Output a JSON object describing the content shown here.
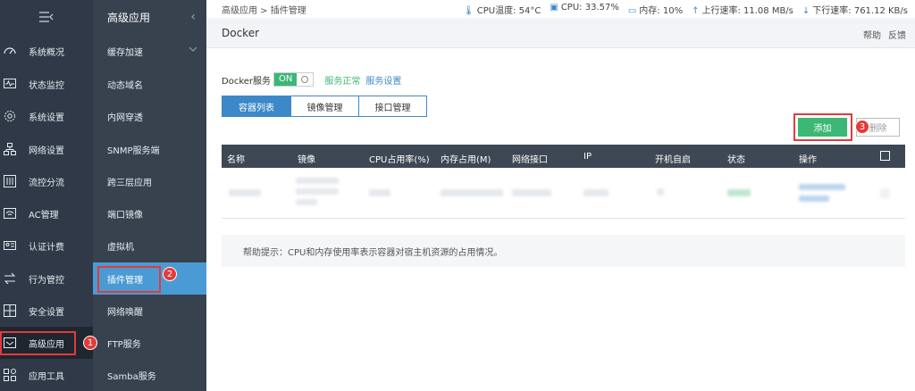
{
  "sidebar": {
    "header_icon": "menu-collapse-icon",
    "items": [
      {
        "label": "系统概况",
        "icon": "dashboard-icon"
      },
      {
        "label": "状态监控",
        "icon": "monitor-icon"
      },
      {
        "label": "系统设置",
        "icon": "gear-icon"
      },
      {
        "label": "网络设置",
        "icon": "network-icon"
      },
      {
        "label": "流控分流",
        "icon": "sliders-icon"
      },
      {
        "label": "AC管理",
        "icon": "wifi-icon"
      },
      {
        "label": "认证计费",
        "icon": "id-card-icon"
      },
      {
        "label": "行为管控",
        "icon": "arrows-icon"
      },
      {
        "label": "安全设置",
        "icon": "shield-grid-icon"
      },
      {
        "label": "高级应用",
        "icon": "advanced-icon"
      },
      {
        "label": "应用工具",
        "icon": "tools-icon"
      }
    ]
  },
  "submenu": {
    "title": "高级应用",
    "items": [
      {
        "label": "缓存加速"
      },
      {
        "label": "动态域名"
      },
      {
        "label": "内网穿透"
      },
      {
        "label": "SNMP服务端"
      },
      {
        "label": "跨三层应用"
      },
      {
        "label": "端口镜像"
      },
      {
        "label": "虚拟机"
      },
      {
        "label": "插件管理"
      },
      {
        "label": "网络唤醒"
      },
      {
        "label": "FTP服务"
      },
      {
        "label": "Samba服务"
      }
    ]
  },
  "topbar": {
    "breadcrumb": "高级应用 > 插件管理",
    "cpu_temp": "CPU温度: 54°C",
    "cpu": "CPU: 33.57%",
    "memory": "内存: 10%",
    "upload": "上行速率: 11.08 MB/s",
    "download": "下行速率: 761.12 KB/s"
  },
  "page": {
    "title": "Docker",
    "help_link": "帮助",
    "feedback_link": "反馈"
  },
  "service": {
    "label": "Docker服务",
    "toggle_on": "ON",
    "status": "服务正常",
    "settings_link": "服务设置"
  },
  "tabs": [
    {
      "label": "容器列表",
      "active": true
    },
    {
      "label": "镜像管理",
      "active": false
    },
    {
      "label": "接口管理",
      "active": false
    }
  ],
  "actions": {
    "add": "添加",
    "delete": "删除"
  },
  "table": {
    "headers": [
      "名称",
      "镜像",
      "CPU占用率(%)",
      "内存占用(M)",
      "网络接口",
      "IP",
      "开机自启",
      "状态",
      "操作"
    ]
  },
  "help_text": "帮助提示：CPU和内存使用率表示容器对宿主机资源的占用情况。",
  "annotations": [
    "1",
    "2",
    "3"
  ],
  "colors": {
    "accent_green": "#3cb776",
    "accent_blue": "#3d88c8",
    "highlight_red": "#e23b3b"
  }
}
